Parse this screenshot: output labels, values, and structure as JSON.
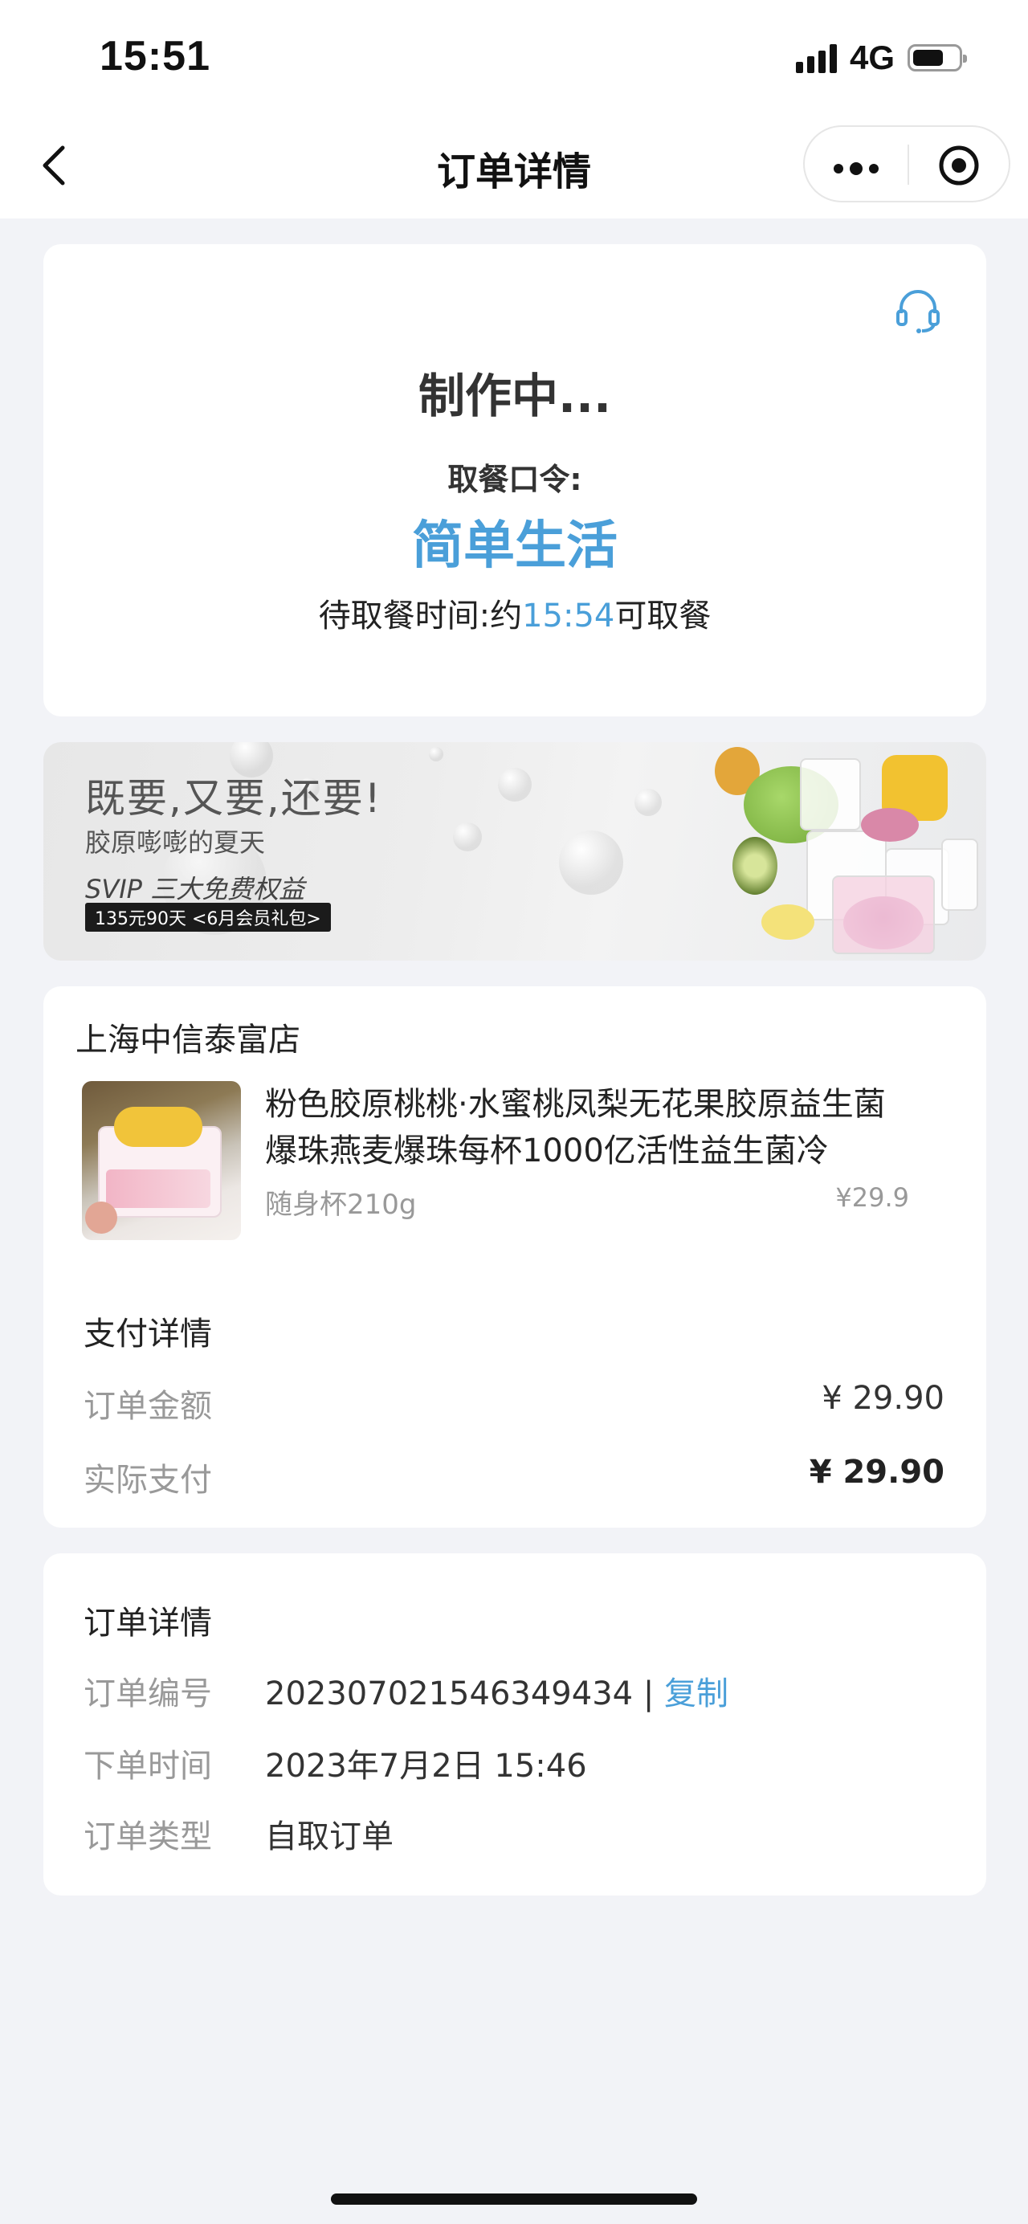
{
  "status_bar": {
    "time": "15:51",
    "network": "4G"
  },
  "nav": {
    "title": "订单详情"
  },
  "order_status": {
    "title": "制作中...",
    "pickup_code_label": "取餐口令:",
    "pickup_code": "简单生活",
    "wait_prefix": "待取餐时间:约",
    "wait_time": "15:54",
    "wait_suffix": "可取餐"
  },
  "banner": {
    "headline": "既要,又要,还要!",
    "subline": "胶原嘭嘭的夏天",
    "svip_line": "SVIP 三大免费权益",
    "tag": "135元90天 <6月会员礼包>"
  },
  "order": {
    "shop_name": "上海中信泰富店",
    "product_name": "粉色胶原桃桃·水蜜桃凤梨无花果胶原益生菌爆珠燕麦爆珠每杯1000亿活性益生菌冷",
    "product_spec": "随身杯210g",
    "product_price": "¥29.9",
    "payment_title": "支付详情",
    "amount_label": "订单金额",
    "amount_value": "¥ 29.90",
    "paid_label": "实际支付",
    "paid_value": "¥ 29.90"
  },
  "details": {
    "title": "订单详情",
    "number_label": "订单编号",
    "number_value": "20230702154634943​4",
    "separator": "|",
    "copy_label": "复制",
    "time_label": "下单时间",
    "time_value": "2023年7月2日 15:46",
    "type_label": "订单类型",
    "type_value": "自取订单"
  },
  "icons": {
    "back": "chevron-left-icon",
    "more": "more-dots-icon",
    "close": "target-circle-icon",
    "service": "headset-icon"
  },
  "colors": {
    "accent": "#4a9fd9",
    "background": "#f2f3f7"
  }
}
